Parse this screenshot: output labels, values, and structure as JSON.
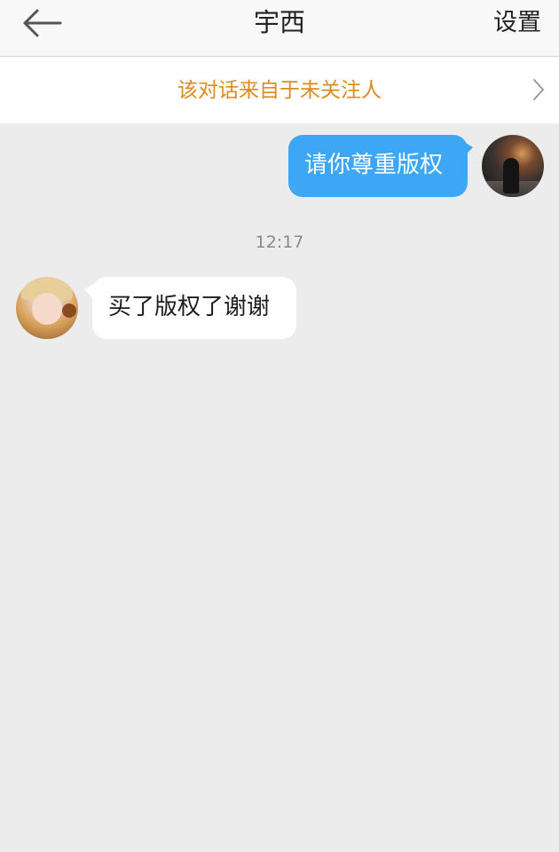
{
  "header": {
    "title": "宇西",
    "settings_label": "设置",
    "back_icon": "back-arrow-icon"
  },
  "notice": {
    "text": "该对话来自于未关注人",
    "chevron_icon": "chevron-right-icon",
    "color": "#dc8a22"
  },
  "messages": [
    {
      "sender": "me",
      "text": "请你尊重版权"
    },
    {
      "sender": "other",
      "text": "买了版权了谢谢"
    }
  ],
  "timestamp": "12:17",
  "colors": {
    "outgoing_bubble": "#3ea7f5",
    "incoming_bubble": "#ffffff",
    "background": "#ececec"
  }
}
